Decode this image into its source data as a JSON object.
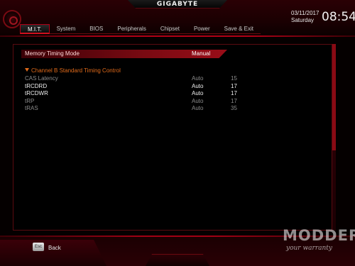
{
  "header": {
    "brand": "GIGABYTE",
    "date": "03/11/2017",
    "day": "Saturday",
    "time": "08:54"
  },
  "tabs": [
    {
      "label": "M.I.T.",
      "active": true
    },
    {
      "label": "System",
      "active": false
    },
    {
      "label": "BIOS",
      "active": false
    },
    {
      "label": "Peripherals",
      "active": false
    },
    {
      "label": "Chipset",
      "active": false
    },
    {
      "label": "Power",
      "active": false
    },
    {
      "label": "Save & Exit",
      "active": false
    }
  ],
  "main": {
    "memory_timing_mode": {
      "label": "Memory Timing Mode",
      "value": "Manual"
    },
    "section_title": "Channel B Standard Timing Control",
    "rows": [
      {
        "label": "CAS Latency",
        "setting": "Auto",
        "current": "15"
      },
      {
        "label": "tRCDRD",
        "setting": "Auto",
        "current": "17"
      },
      {
        "label": "tRCDWR",
        "setting": "Auto",
        "current": "17"
      },
      {
        "label": "tRP",
        "setting": "Auto",
        "current": "17"
      },
      {
        "label": "tRAS",
        "setting": "Auto",
        "current": "35"
      }
    ]
  },
  "footer": {
    "back_key": "Esc",
    "back_label": "Back"
  },
  "watermark": {
    "title": "MODDERS",
    "tagline": "your warranty"
  },
  "colors": {
    "accent": "#b00016",
    "section": "#e06a1a"
  }
}
